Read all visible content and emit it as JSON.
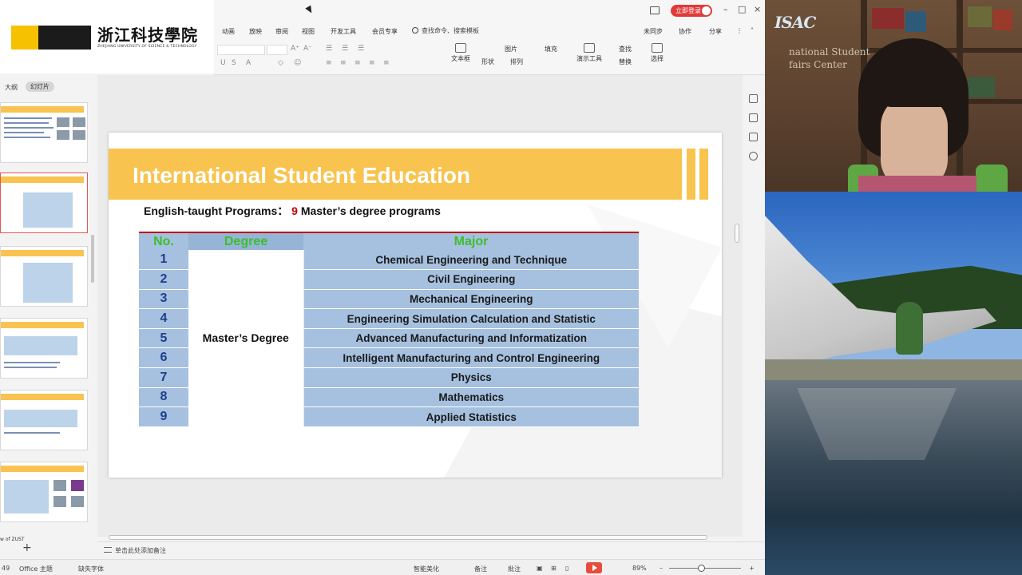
{
  "logo": {
    "name_cn": "浙江科技學院",
    "name_en": "ZHEJIANG UNIVERSITY OF SCIENCE & TECHNOLOGY"
  },
  "titlebar": {
    "login_label": "立即登录"
  },
  "menubar": {
    "items": [
      "动画",
      "放映",
      "审阅",
      "视图",
      "开发工具",
      "会员专享"
    ],
    "search_label": "查找命令、搜索模板",
    "right_items": [
      "未同步",
      "协作",
      "分享"
    ]
  },
  "ribbon": {
    "tools": [
      {
        "label": "文本框",
        "icon": "textbox-icon"
      },
      {
        "label": "形状",
        "icon": "shape-icon"
      },
      {
        "label": "排列",
        "icon": "arrange-icon"
      },
      {
        "label": "演示工具",
        "icon": "presentation-tools-icon"
      },
      {
        "label": "查找",
        "icon": "find-icon"
      },
      {
        "label": "替换",
        "icon": "replace-icon"
      },
      {
        "label": "选择",
        "icon": "select-icon"
      }
    ],
    "picture_label": "图片",
    "fill_label": "填充"
  },
  "thumbpanel": {
    "tab_outline": "大纲",
    "tab_slides": "幻灯片",
    "footer_label": "w of ZUST"
  },
  "slide": {
    "title": "International Student Education",
    "subtitle_prefix": "English-taught Programs：",
    "subtitle_count": "9",
    "subtitle_suffix": "Master’s degree programs",
    "table": {
      "headers": {
        "no": "No.",
        "degree": "Degree",
        "major": "Major"
      },
      "degree_value": "Master’s Degree",
      "rows": [
        {
          "no": "1",
          "major": "Chemical Engineering and Technique"
        },
        {
          "no": "2",
          "major": "Civil Engineering"
        },
        {
          "no": "3",
          "major": "Mechanical Engineering"
        },
        {
          "no": "4",
          "major": "Engineering Simulation Calculation and Statistic"
        },
        {
          "no": "5",
          "major": "Advanced Manufacturing and Informatization"
        },
        {
          "no": "6",
          "major": "Intelligent Manufacturing and Control Engineering"
        },
        {
          "no": "7",
          "major": "Physics"
        },
        {
          "no": "8",
          "major": "Mathematics"
        },
        {
          "no": "9",
          "major": "Applied Statistics"
        }
      ]
    }
  },
  "notes": {
    "placeholder": "单击此处添加备注"
  },
  "statusbar": {
    "slide_no": "49",
    "theme": "Office 主题",
    "missing_font": "缺失字体",
    "beautify": "智能美化",
    "notes": "备注",
    "comments": "批注",
    "zoom": "89%"
  },
  "camera": {
    "isac_logo": "ISAC",
    "isac_line1": "national Student",
    "isac_line2": "fairs Center"
  },
  "colors": {
    "title_band": "#f8c34e",
    "table_blue": "#a6c0df",
    "header_green": "#3bbf2c",
    "number_blue": "#1d3f8f",
    "accent_red": "#c00000",
    "login_red": "#e03a3a"
  }
}
